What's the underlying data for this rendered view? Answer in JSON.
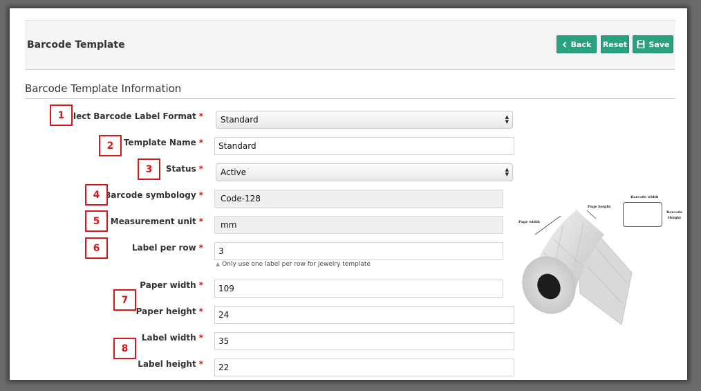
{
  "header": {
    "title": "Barcode Template",
    "back_label": "Back",
    "reset_label": "Reset",
    "save_label": "Save"
  },
  "section_title": "Barcode Template Information",
  "required_marker": "*",
  "fields": {
    "label_format": {
      "label": "Select Barcode Label Format",
      "value": "Standard"
    },
    "template_name": {
      "label": "Template Name",
      "value": "Standard"
    },
    "status": {
      "label": "Status",
      "value": "Active"
    },
    "symbology": {
      "label": "Barcode symbology",
      "value": "Code-128"
    },
    "unit": {
      "label": "Measurement unit",
      "value": "mm"
    },
    "label_per_row": {
      "label": "Label per row",
      "value": "3",
      "hint": "Only use one label per row for jewelry template"
    },
    "paper_width": {
      "label": "Paper width",
      "value": "109"
    },
    "paper_height": {
      "label": "Paper height",
      "value": "24"
    },
    "label_width": {
      "label": "Label width",
      "value": "35"
    },
    "label_height": {
      "label": "Label height",
      "value": "22"
    }
  },
  "markers": [
    "1",
    "2",
    "3",
    "4",
    "5",
    "6",
    "7",
    "8"
  ],
  "illustration": {
    "page_width": "Page width",
    "page_height": "Page height",
    "barcode_width": "Barcode width",
    "barcode_height_1": "Barcode",
    "barcode_height_2": "Height"
  },
  "colors": {
    "accent": "#2aa180",
    "required": "#c52020",
    "marker": "#d9161c"
  }
}
